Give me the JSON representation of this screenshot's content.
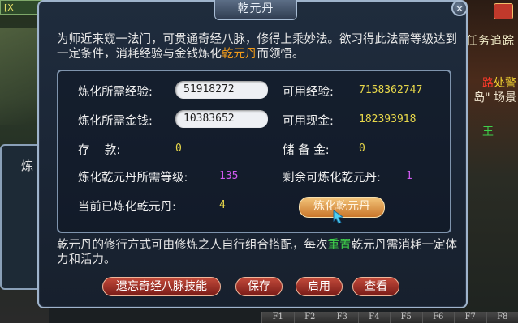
{
  "scene": {
    "left_top_badge": "[X",
    "right_text_1": "任务追踪",
    "right_text_2a": "路",
    "right_text_2b": "处警",
    "right_text_3": "岛\" 场景",
    "right_text_4": "王",
    "back_window_label": "炼"
  },
  "dialog": {
    "title": "乾元丹",
    "close_label": "✕",
    "intro_part1": "为师近来窥一法门，可贯通奇经八脉，修得上乘妙法。欲习得此法需等级达到一定条件，消耗经验与金钱炼化",
    "intro_highlight": "乾元丹",
    "intro_part2": "而领悟。"
  },
  "stats": {
    "exp_required_label": "炼化所需经验:",
    "exp_required_value": "51918272",
    "exp_available_label": "可用经验:",
    "exp_available_value": "7158362747",
    "money_required_label": "炼化所需金钱:",
    "money_required_value": "10383652",
    "cash_available_label": "可用现金:",
    "cash_available_value": "182393918",
    "deposit_label": "存    款:",
    "deposit_value": "0",
    "reserve_label": "储 备 金:",
    "reserve_value": "0",
    "level_required_label": "炼化乾元丹所需等级:",
    "level_required_value": "135",
    "remaining_label": "剩余可炼化乾元丹:",
    "remaining_value": "1",
    "refined_label": "当前已炼化乾元丹:",
    "refined_value": "4",
    "refine_button": "炼化乾元丹"
  },
  "footer": {
    "text_part1": "乾元丹的修行方式可由修炼之人自行组合搭配，每次",
    "text_highlight": "重置",
    "text_part2": "乾元丹需消耗一定体力和活力。"
  },
  "buttons": {
    "forget": "遗忘奇经八脉技能",
    "save": "保存",
    "apply": "启用",
    "view": "查看"
  },
  "fkeys": [
    "F1",
    "F2",
    "F3",
    "F4",
    "F5",
    "F6",
    "F7",
    "F8"
  ]
}
